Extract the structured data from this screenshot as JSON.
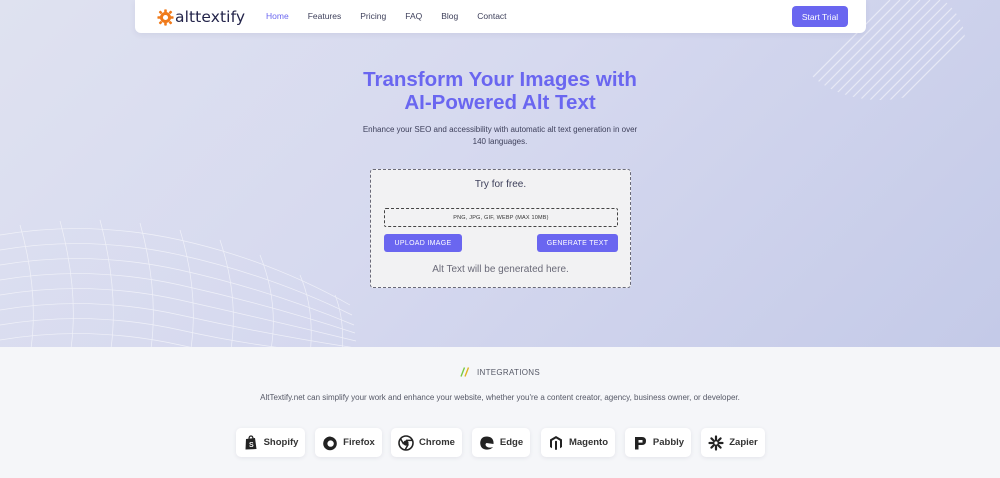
{
  "nav": {
    "brand": "alttextify",
    "links": [
      "Home",
      "Features",
      "Pricing",
      "FAQ",
      "Blog",
      "Contact"
    ],
    "cta": "Start Trial",
    "active_link": "Home"
  },
  "hero": {
    "title_line1": "Transform Your Images with",
    "title_line2": "AI-Powered Alt Text",
    "subtitle": "Enhance your SEO and accessibility with automatic alt text generation in over 140 languages."
  },
  "tool": {
    "title": "Try for free.",
    "dropzone_text": "PNG, JPG, GIF, WEBP (MAX 10MB)",
    "upload_label": "UPLOAD IMAGE",
    "generate_label": "GENERATE TEXT",
    "result_placeholder": "Alt Text will be generated here."
  },
  "integrations": {
    "label": "INTEGRATIONS",
    "description": "AltTextify.net can simplify your work and enhance your website, whether you're a content creator, agency, business owner, or developer.",
    "items": [
      {
        "name": "Shopify",
        "icon": "shopify-icon"
      },
      {
        "name": "Firefox",
        "icon": "firefox-icon"
      },
      {
        "name": "Chrome",
        "icon": "chrome-icon"
      },
      {
        "name": "Edge",
        "icon": "edge-icon"
      },
      {
        "name": "Magento",
        "icon": "magento-icon"
      },
      {
        "name": "Pabbly",
        "icon": "pabbly-icon"
      },
      {
        "name": "Zapier",
        "icon": "zapier-icon"
      }
    ]
  },
  "colors": {
    "accent": "#6a66f0",
    "logo_orange": "#f07a1a",
    "integration_green": "#7ac943"
  }
}
